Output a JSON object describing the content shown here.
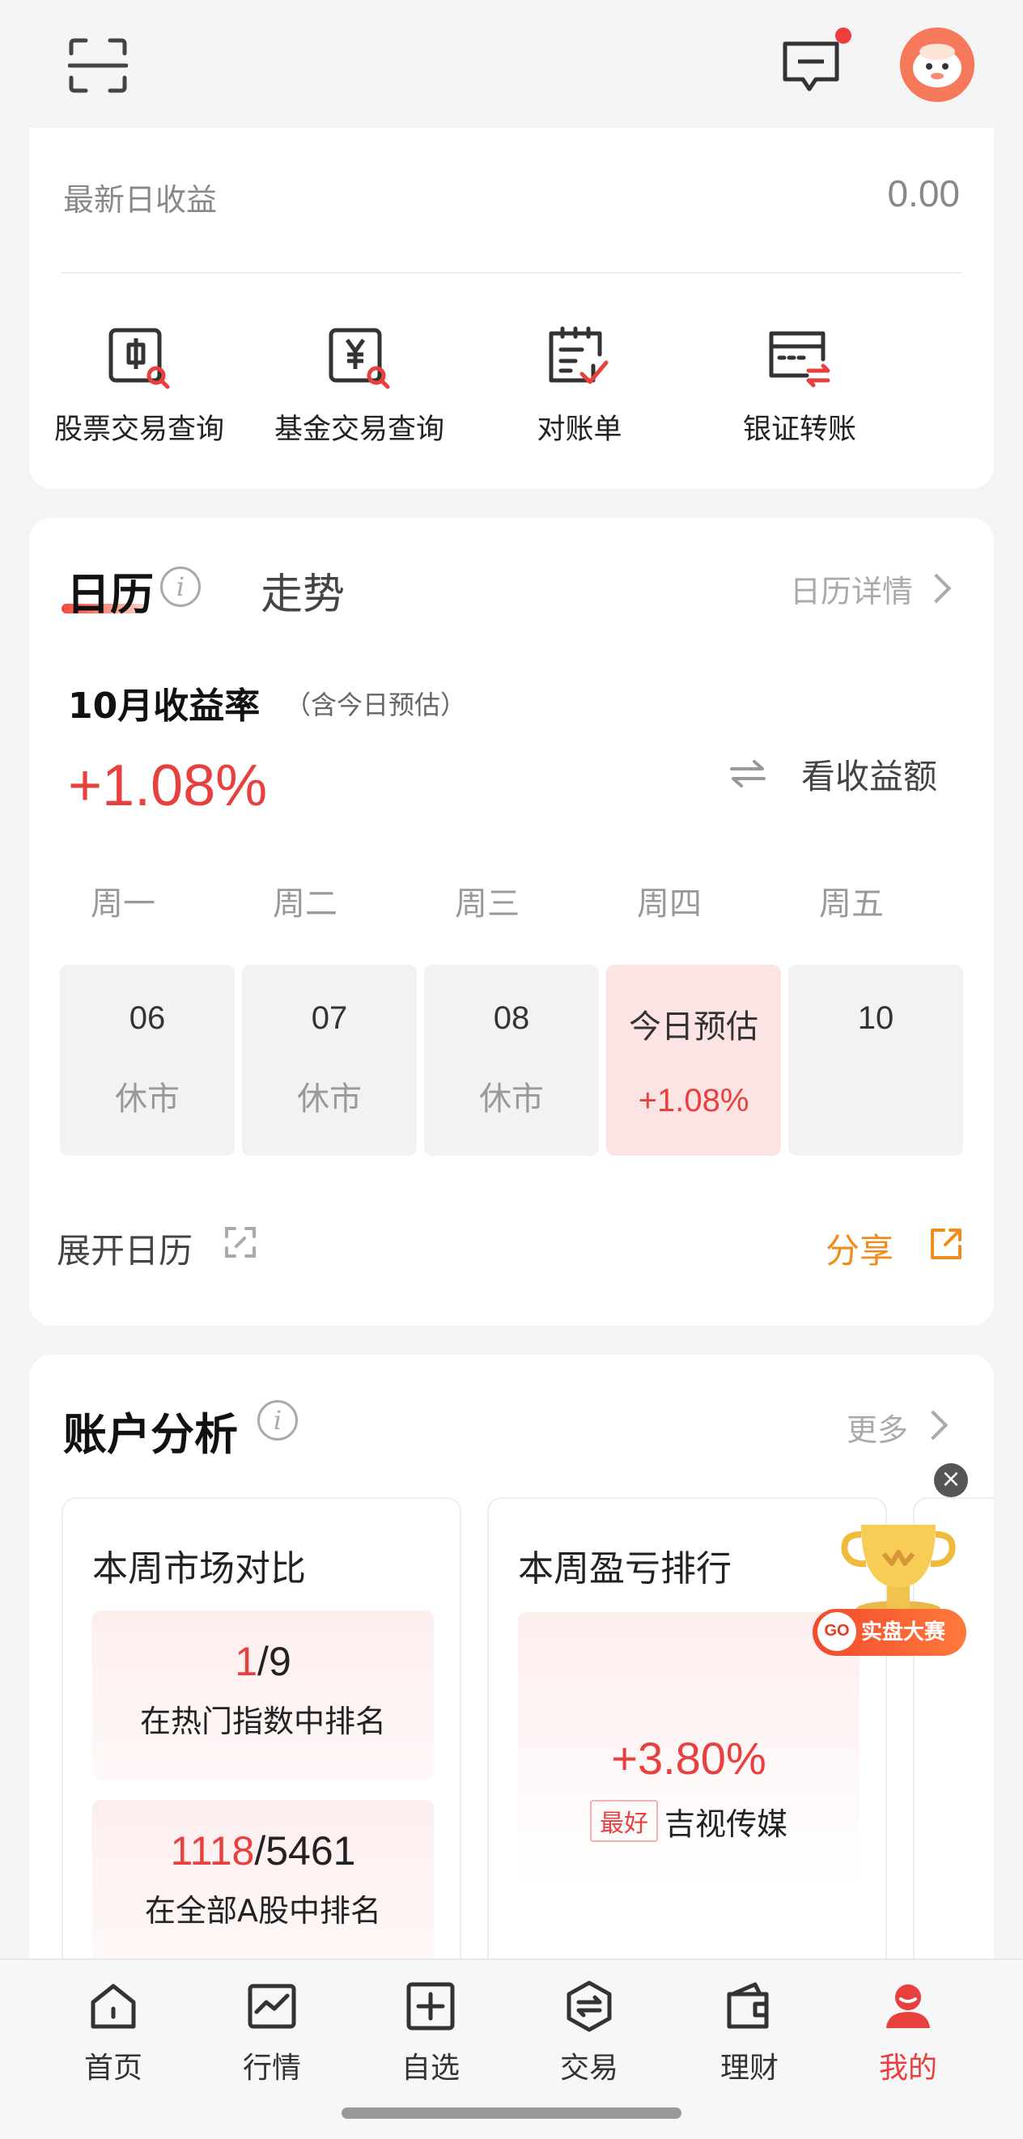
{
  "header": {
    "scan_icon": "scan-icon",
    "message_icon": "message-icon",
    "has_unread": true
  },
  "summary": {
    "latest_label": "最新日收益",
    "latest_value": "0.00",
    "quick_links": [
      {
        "label": "股票交易查询",
        "icon": "stock-query-icon"
      },
      {
        "label": "基金交易查询",
        "icon": "fund-query-icon"
      },
      {
        "label": "对账单",
        "icon": "statement-icon"
      },
      {
        "label": "银证转账",
        "icon": "bank-transfer-icon"
      }
    ]
  },
  "calendar": {
    "tab_calendar": "日历",
    "tab_trend": "走势",
    "detail_link": "日历详情",
    "month_title": "10月收益率",
    "month_sub": "（含今日预估）",
    "month_return": "+1.08%",
    "view_amount": "看收益额",
    "weekdays": [
      "周一",
      "周二",
      "周三",
      "周四",
      "周五"
    ],
    "days": [
      {
        "num": "06",
        "status": "休市"
      },
      {
        "num": "07",
        "status": "休市"
      },
      {
        "num": "08",
        "status": "休市"
      },
      {
        "num": "今日预估",
        "status": "+1.08%"
      },
      {
        "num": "10",
        "status": ""
      }
    ],
    "expand": "展开日历",
    "share": "分享"
  },
  "analysis": {
    "title": "账户分析",
    "more": "更多",
    "market_card": {
      "title": "本周市场对比",
      "rank1_pos": "1",
      "rank1_total": "/9",
      "rank1_desc": "在热门指数中排名",
      "rank2_pos": "1118",
      "rank2_total": "/5461",
      "rank2_desc": "在全部A股中排名"
    },
    "pl_card": {
      "title": "本周盈亏排行",
      "pct": "+3.80%",
      "tag": "最好",
      "stock": "吉视传媒"
    }
  },
  "ad": {
    "go": "GO",
    "label": "实盘大赛"
  },
  "nav": [
    {
      "label": "首页",
      "icon": "home-icon"
    },
    {
      "label": "行情",
      "icon": "market-icon"
    },
    {
      "label": "自选",
      "icon": "watchlist-icon"
    },
    {
      "label": "交易",
      "icon": "trade-icon"
    },
    {
      "label": "理财",
      "icon": "wallet-icon"
    },
    {
      "label": "我的",
      "icon": "profile-icon"
    }
  ],
  "colors": {
    "accent_red": "#e8403e",
    "accent_orange": "#f08c1e"
  }
}
